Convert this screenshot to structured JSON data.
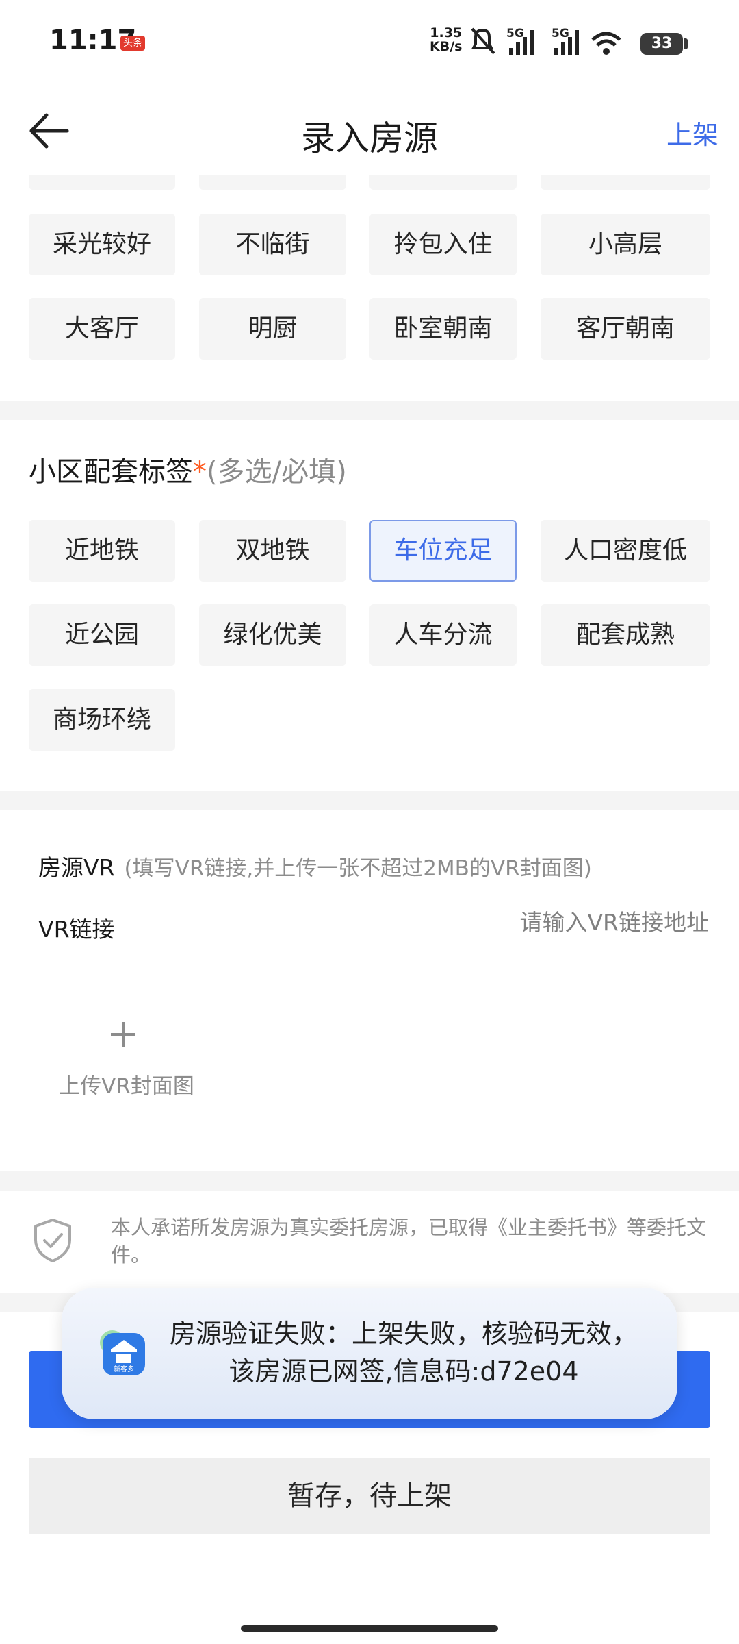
{
  "status_bar": {
    "time": "11:17",
    "app_badge": "头条",
    "net_speed_value": "1.35",
    "net_speed_unit": "KB/s",
    "signal_1_label": "5G",
    "signal_2_label": "5G",
    "battery": "33"
  },
  "header": {
    "title": "录入房源",
    "publish_label": "上架"
  },
  "house_tags": [
    "采光较好",
    "不临街",
    "拎包入住",
    "小高层",
    "大客厅",
    "明厨",
    "卧室朝南",
    "客厅朝南"
  ],
  "community_section": {
    "title": "小区配套标签",
    "required_mark": "*",
    "hint": "(多选/必填)",
    "tags": [
      "近地铁",
      "双地铁",
      "车位充足",
      "人口密度低",
      "近公园",
      "绿化优美",
      "人车分流",
      "配套成熟",
      "商场环绕"
    ],
    "selected": [
      "车位充足"
    ]
  },
  "vr_section": {
    "title": "房源VR",
    "hint": "(填写VR链接,并上传一张不超过2MB的VR封面图)",
    "link_label": "VR链接",
    "link_placeholder": "请输入VR链接地址",
    "link_value": "",
    "upload_label": "上传VR封面图"
  },
  "promise": {
    "text": "本人承诺所发房源为真实委托房源，已取得《业主委托书》等委托文件。"
  },
  "toast": {
    "line1": "房源验证失败：上架失败，核验码无效，",
    "line2": "该房源已网签,信息码:d72e04",
    "logo_text": "新客多"
  },
  "buttons": {
    "save_draft": "暂存，待上架"
  },
  "colors": {
    "accent": "#3d6be8",
    "primary_button": "#2f6bf0",
    "required": "#ff5a1f"
  }
}
